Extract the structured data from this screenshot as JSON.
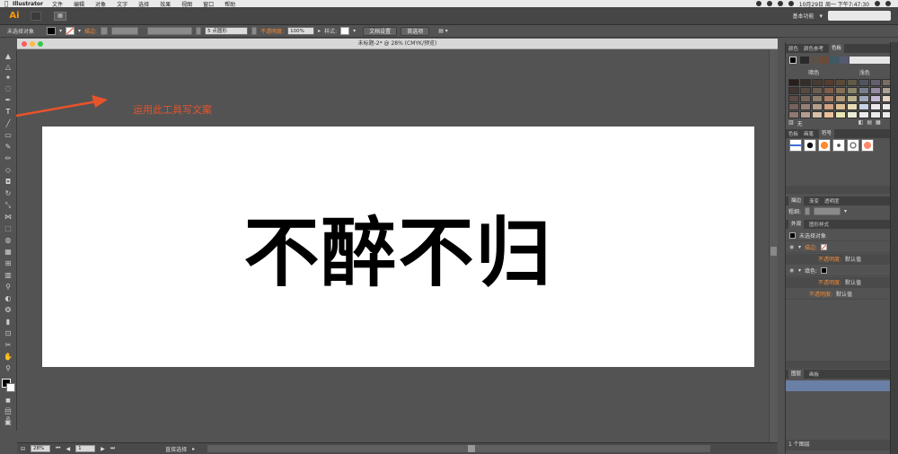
{
  "menubar": {
    "app": "Illustrator",
    "items": [
      "文件",
      "编辑",
      "对象",
      "文字",
      "选择",
      "效果",
      "视图",
      "窗口",
      "帮助"
    ],
    "clock": "10月29日 周一 下午7:47:30"
  },
  "appbar": {
    "logo": "Ai",
    "workspace": "基本功能"
  },
  "control_bar": {
    "selection": "未选择对象",
    "stroke_label": "描边:",
    "brush_value": "5 点圆形",
    "opacity_label": "不透明度:",
    "opacity_value": "100%",
    "style_label": "样式:",
    "doc_setup": "文档设置",
    "preferences": "首选项"
  },
  "document": {
    "title": "未标题-2* @ 28% (CMYK/预览)",
    "headline": "不醉不归",
    "annotation": "运用此工具写文案",
    "accent": "#e8532b"
  },
  "status": {
    "zoom": "28%",
    "page": "1",
    "mode": "直接选择"
  },
  "panels": {
    "swatch_tabs": [
      "颜色",
      "颜色参考",
      "色板"
    ],
    "swatch_headers": [
      "暗色",
      "浅色"
    ],
    "swatch_none": "无",
    "brush_tabs": [
      "色板",
      "画笔",
      "符号"
    ],
    "stroke_tabs": [
      "描边",
      "渐变",
      "透明度"
    ],
    "stroke_weight_label": "粗细:",
    "appearance_tabs": [
      "外观",
      "图形样式"
    ],
    "appearance": {
      "no_selection": "未选择对象",
      "stroke": "描边:",
      "opacity1": "不透明度:",
      "opacity1_value": "默认值",
      "fill": "填色:",
      "opacity2": "不透明度:",
      "opacity2_value": "默认值",
      "opacity3": "不透明度:",
      "opacity3_value": "默认值"
    },
    "layer_tabs": [
      "图层",
      "画板"
    ],
    "layers_footer": "1 个图层"
  }
}
